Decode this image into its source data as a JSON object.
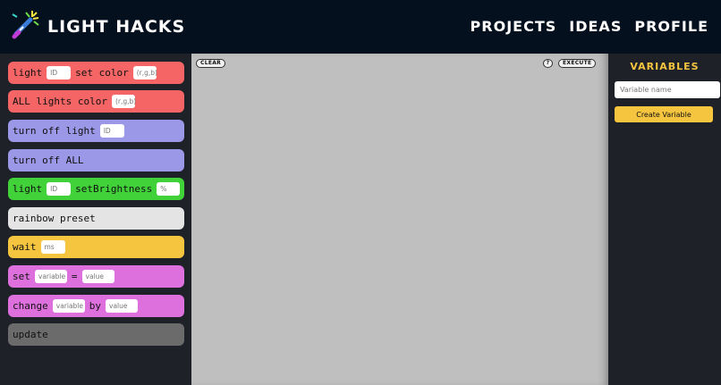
{
  "header": {
    "brand": "LIGHT HACKS",
    "nav": [
      "PROJECTS",
      "IDEAS",
      "PROFILE"
    ]
  },
  "palette": {
    "blocks": [
      {
        "id": "light-set-color",
        "color": "#f56565",
        "parts": [
          {
            "t": "text",
            "v": "light"
          },
          {
            "t": "input",
            "v": "ID"
          },
          {
            "t": "text",
            "v": "set color"
          },
          {
            "t": "input",
            "v": "(r,g,b)"
          }
        ]
      },
      {
        "id": "all-lights-color",
        "color": "#f56565",
        "parts": [
          {
            "t": "text",
            "v": "ALL lights color"
          },
          {
            "t": "input",
            "v": "(r,g,b)"
          }
        ]
      },
      {
        "id": "turn-off-light",
        "color": "#9c98e8",
        "parts": [
          {
            "t": "text",
            "v": "turn off light"
          },
          {
            "t": "input",
            "v": "ID"
          }
        ]
      },
      {
        "id": "turn-off-all",
        "color": "#9c98e8",
        "parts": [
          {
            "t": "text",
            "v": "turn off ALL"
          }
        ]
      },
      {
        "id": "light-set-brightness",
        "color": "#41d23a",
        "parts": [
          {
            "t": "text",
            "v": "light"
          },
          {
            "t": "input",
            "v": "ID"
          },
          {
            "t": "text",
            "v": "setBrightness"
          },
          {
            "t": "input",
            "v": "%"
          }
        ]
      },
      {
        "id": "rainbow-preset",
        "color": "#e4e4e4",
        "parts": [
          {
            "t": "text",
            "v": "rainbow preset"
          }
        ]
      },
      {
        "id": "wait",
        "color": "#f6c540",
        "parts": [
          {
            "t": "text",
            "v": "wait"
          },
          {
            "t": "input",
            "v": "ms"
          }
        ]
      },
      {
        "id": "set-variable",
        "color": "#dd70dd",
        "parts": [
          {
            "t": "text",
            "v": " set"
          },
          {
            "t": "input",
            "v": "variable"
          },
          {
            "t": "text",
            "v": "="
          },
          {
            "t": "input",
            "v": "value"
          }
        ]
      },
      {
        "id": "change-variable",
        "color": "#dd70dd",
        "parts": [
          {
            "t": "text",
            "v": " change"
          },
          {
            "t": "input",
            "v": "variable"
          },
          {
            "t": "text",
            "v": "by"
          },
          {
            "t": "input",
            "v": "value"
          }
        ]
      },
      {
        "id": "update",
        "color": "#6b6b6b",
        "parts": [
          {
            "t": "text",
            "v": "update"
          }
        ]
      }
    ]
  },
  "canvas": {
    "clear_label": "CLEAR",
    "help_label": "?",
    "execute_label": "EXECUTE"
  },
  "variables": {
    "title": "VARIABLES",
    "input_placeholder": "Variable name",
    "create_label": "Create Variable"
  },
  "colors": {
    "header_bg": "#05101f",
    "panel_bg": "#1e2128",
    "canvas_bg": "#bfbfbf",
    "accent": "#f6c540"
  },
  "icons": {
    "logo": "neon-wand-icon"
  }
}
